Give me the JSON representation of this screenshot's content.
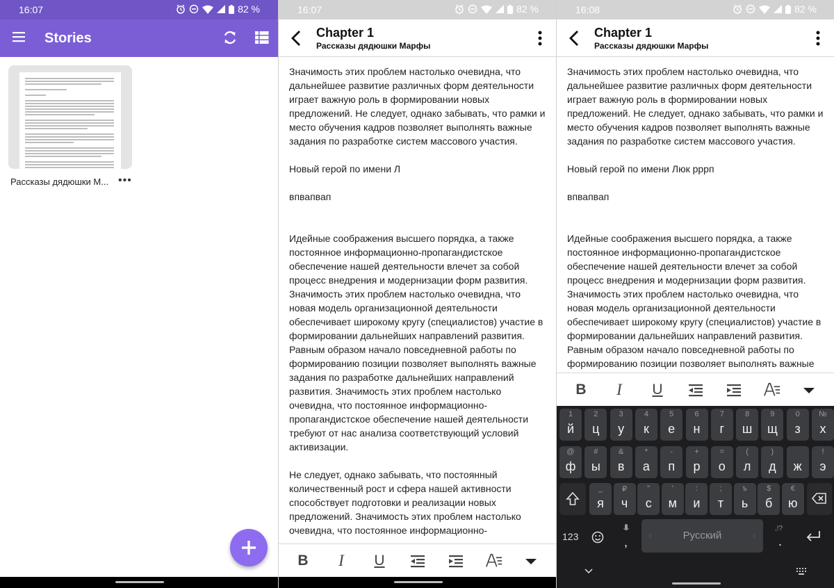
{
  "status": {
    "p1_time": "16:07",
    "p2_time": "16:07",
    "p3_time": "16:08",
    "battery": "82 %"
  },
  "stories": {
    "title": "Stories",
    "card_label": "Рассказы дядюшки М...",
    "card_more": "•••",
    "colors": {
      "appbar": "#7b5ed6",
      "fab": "#8e6cf0"
    }
  },
  "editor": {
    "chapter": "Chapter 1",
    "book": "Рассказы дядюшки Марфы",
    "para1": "Значимость этих проблем настолько очевидна, что дальнейшее развитие различных форм деятельности играет важную роль в формировании новых предложений. Не следует, однако забывать, что рамки и место обучения кадров позволяет выполнять важные задания по разработке систем массового участия.",
    "hero_p2": "Новый герой по имени Л",
    "hero_p3": "Новый герой по имени Люк рррп",
    "word": "впвапвап",
    "para2": "Идейные соображения высшего порядка, а также постоянное информационно-пропагандистское обеспечение нашей деятельности влечет за собой процесс внедрения и модернизации форм развития. Значимость этих проблем настолько очевидна, что новая модель организационной деятельности обеспечивает широкому кругу (специалистов) участие в формировании дальнейших направлений развития. Равным образом начало повседневной работы по формированию позиции позволяет выполнять важные задания по разработке дальнейших направлений развития. Значимость этих проблем настолько очевидна, что постоянное информационно-пропагандистское обеспечение нашей деятельности требуют от нас анализа соответствующий условий активизации.",
    "para3": "Не следует, однако забывать, что постоянный количественный рост и сфера нашей активности способствует подготовки и реализации новых предложений. Значимость этих проблем настолько очевидна, что постоянное информационно-"
  },
  "format": {
    "bold": "B",
    "italic": "I",
    "underline": "U"
  },
  "keyboard": {
    "row1": [
      {
        "hint": "1",
        "key": "й"
      },
      {
        "hint": "2",
        "key": "ц"
      },
      {
        "hint": "3",
        "key": "у"
      },
      {
        "hint": "4",
        "key": "к"
      },
      {
        "hint": "5",
        "key": "е"
      },
      {
        "hint": "6",
        "key": "н"
      },
      {
        "hint": "7",
        "key": "г"
      },
      {
        "hint": "8",
        "key": "ш"
      },
      {
        "hint": "9",
        "key": "щ"
      },
      {
        "hint": "0",
        "key": "з"
      },
      {
        "hint": "№",
        "key": "х"
      }
    ],
    "row2": [
      {
        "hint": "@",
        "key": "ф"
      },
      {
        "hint": "#",
        "key": "ы"
      },
      {
        "hint": "&",
        "key": "в"
      },
      {
        "hint": "*",
        "key": "а"
      },
      {
        "hint": "-",
        "key": "п"
      },
      {
        "hint": "+",
        "key": "р"
      },
      {
        "hint": "=",
        "key": "о"
      },
      {
        "hint": "(",
        "key": "л"
      },
      {
        "hint": ")",
        "key": "д"
      },
      {
        "hint": "",
        "key": "ж"
      },
      {
        "hint": "!",
        "key": "э"
      }
    ],
    "row3": [
      {
        "hint": "_",
        "key": "я"
      },
      {
        "hint": "₽",
        "key": "ч"
      },
      {
        "hint": "\"",
        "key": "с"
      },
      {
        "hint": "'",
        "key": "м"
      },
      {
        "hint": ":",
        "key": "и"
      },
      {
        "hint": ";",
        "key": "т"
      },
      {
        "hint": "ъ",
        "key": "ь"
      },
      {
        "hint": "$",
        "key": "б"
      },
      {
        "hint": "€",
        "key": "ю"
      }
    ],
    "num_label": "123",
    "space_label": "Русский",
    "comma": ",",
    "period_hint": ",!?",
    "period": "."
  }
}
